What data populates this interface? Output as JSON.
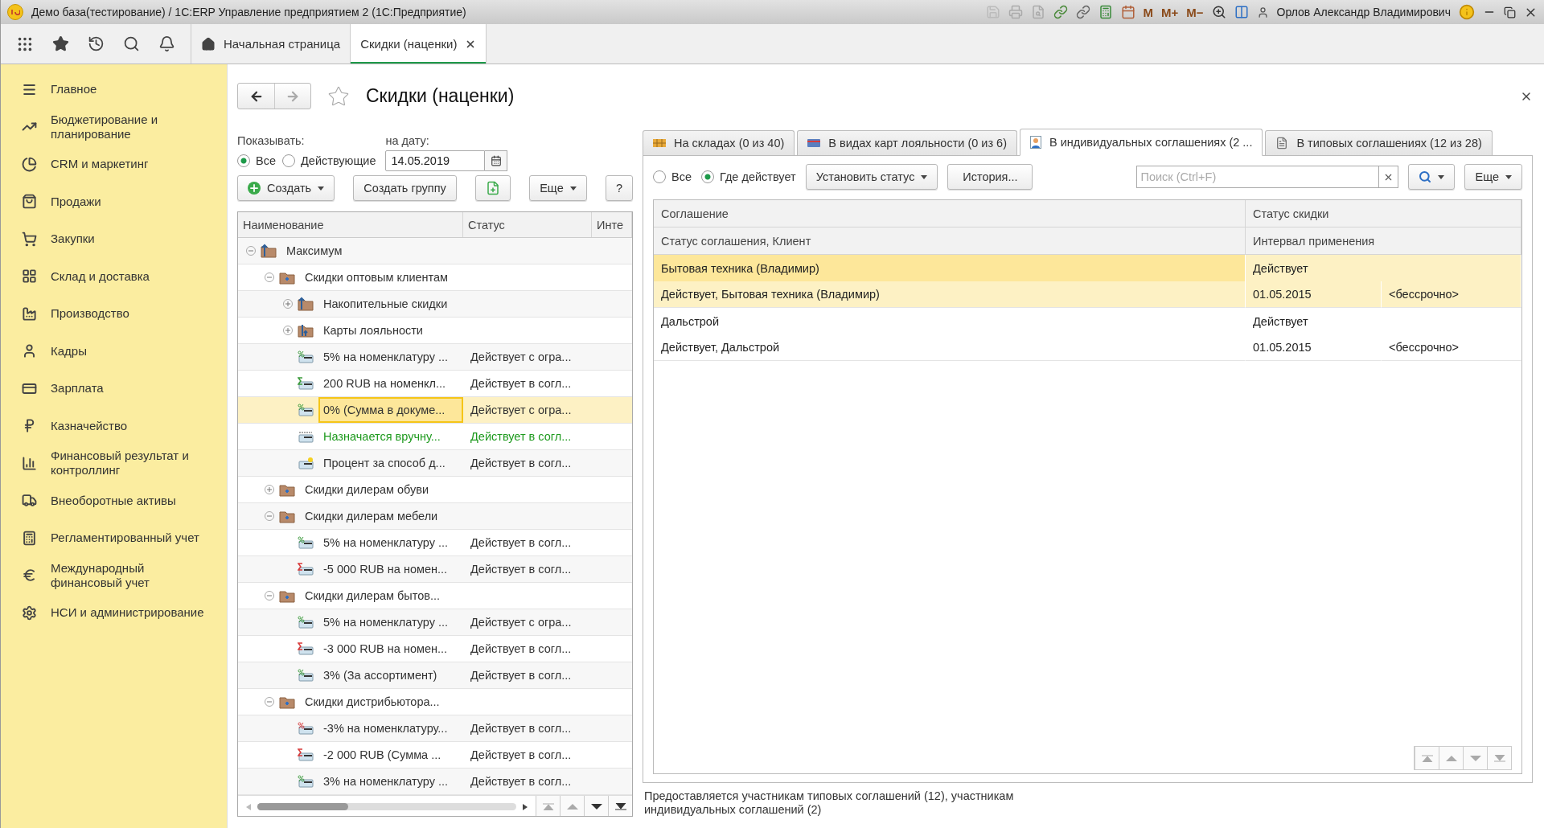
{
  "window": {
    "title": "Демо база(тестирование) / 1С:ERP Управление предприятием 2  (1С:Предприятие)",
    "memory_buttons": [
      "M",
      "M+",
      "M−"
    ],
    "user": "Орлов Александр Владимирович"
  },
  "open_tabs": [
    {
      "label": "Начальная страница",
      "kind": "home",
      "selected": false
    },
    {
      "label": "Скидки (наценки)",
      "kind": "form",
      "selected": true
    }
  ],
  "sidebar": {
    "items": [
      {
        "label": "Главное"
      },
      {
        "label": "Бюджетирование и планирование"
      },
      {
        "label": "CRM и маркетинг"
      },
      {
        "label": "Продажи"
      },
      {
        "label": "Закупки"
      },
      {
        "label": "Склад и доставка"
      },
      {
        "label": "Производство"
      },
      {
        "label": "Кадры"
      },
      {
        "label": "Зарплата"
      },
      {
        "label": "Казначейство"
      },
      {
        "label": "Финансовый результат и контроллинг"
      },
      {
        "label": "Внеоборотные активы"
      },
      {
        "label": "Регламентированный учет"
      },
      {
        "label": "Международный финансовый учет"
      },
      {
        "label": "НСИ и администрирование"
      }
    ]
  },
  "form": {
    "title": "Скидки (наценки)",
    "show_label": "Показывать:",
    "show_options": [
      {
        "label": "Все",
        "selected": true
      },
      {
        "label": "Действующие",
        "selected": false
      }
    ],
    "date_label": "на дату:",
    "date": "14.05.2019",
    "buttons": [
      {
        "kind": "create",
        "label": "Создать"
      },
      {
        "kind": "plain",
        "label": "Создать группу"
      },
      {
        "kind": "copy"
      },
      {
        "kind": "menu",
        "label": "Еще"
      },
      {
        "kind": "plain",
        "label": "?"
      }
    ]
  },
  "tree": {
    "columns": [
      "Наименование",
      "Статус",
      "Инте"
    ],
    "rows": [
      {
        "kind": "group-up",
        "name": "Максимум",
        "expanded": true,
        "selected": false,
        "children": [
          {
            "kind": "group",
            "name": "Скидки оптовым клиентам",
            "expanded": true,
            "selected": false,
            "children": [
              {
                "kind": "group-up",
                "name": "Накопительные скидки",
                "expanded": false,
                "selected": false
              },
              {
                "kind": "group-cards",
                "name": "Карты лояльности",
                "expanded": false,
                "selected": false
              },
              {
                "kind": "percent",
                "name": "5% на номенклатуру ...",
                "status": "Действует с огра...",
                "color": "#333333",
                "selected": false
              },
              {
                "kind": "sum",
                "name": "200 RUB на номенкл...",
                "status": "Действует в согл...",
                "color": "#333333",
                "selected": false
              },
              {
                "kind": "percent",
                "name": "0% (Сумма в докуме...",
                "status": "Действует с огра...",
                "color": "#333333",
                "selected": true
              },
              {
                "kind": "manual",
                "name": "Назначается вручну...",
                "status": "Действует в согл...",
                "color": "#1e9a1e",
                "selected": false
              },
              {
                "kind": "method",
                "name": "Процент за способ д...",
                "status": "Действует в согл...",
                "color": "#333333",
                "selected": false
              }
            ]
          },
          {
            "kind": "group",
            "name": "Скидки дилерам обуви",
            "expanded": false,
            "selected": false
          },
          {
            "kind": "group",
            "name": "Скидки дилерам мебели",
            "expanded": true,
            "selected": false,
            "children": [
              {
                "kind": "percent",
                "name": "5% на номенклатуру ...",
                "status": "Действует в согл...",
                "color": "#333333",
                "selected": false
              },
              {
                "kind": "sum-negative",
                "name": "-5 000 RUB на номен...",
                "status": "Действует в согл...",
                "color": "#333333",
                "selected": false
              }
            ]
          },
          {
            "kind": "group",
            "name": "Скидки дилерам бытов...",
            "expanded": true,
            "selected": false,
            "children": [
              {
                "kind": "percent",
                "name": "5% на номенклатуру ...",
                "status": "Действует с огра...",
                "color": "#333333",
                "selected": false
              },
              {
                "kind": "sum-negative",
                "name": "-3 000 RUB на номен...",
                "status": "Действует в согл...",
                "color": "#333333",
                "selected": false
              },
              {
                "kind": "percent",
                "name": "3% (За ассортимент)",
                "status": "Действует в согл...",
                "color": "#333333",
                "selected": false
              }
            ]
          },
          {
            "kind": "group",
            "name": "Скидки дистрибьютора...",
            "expanded": true,
            "selected": false,
            "children": [
              {
                "kind": "percent-negative",
                "name": "-3% на номенклатуру...",
                "status": "Действует в согл...",
                "color": "#333333",
                "selected": false
              },
              {
                "kind": "sum-negative",
                "name": "-2 000 RUB (Сумма ...",
                "status": "Действует в согл...",
                "color": "#333333",
                "selected": false
              },
              {
                "kind": "percent",
                "name": "3% на номенклатуру ...",
                "status": "Действует в согл...",
                "color": "#333333",
                "selected": false
              }
            ]
          }
        ]
      }
    ]
  },
  "details": {
    "tabs": [
      {
        "label": "На складах (0 из 40)",
        "kind": "warehouse",
        "selected": false
      },
      {
        "label": "В видах карт лояльности (0 из 6)",
        "kind": "card",
        "selected": false
      },
      {
        "label": "В индивидуальных соглашениях (2 ...",
        "kind": "person",
        "selected": true
      },
      {
        "label": "В типовых соглашениях (12 из 28)",
        "kind": "document",
        "selected": false
      }
    ],
    "filter": [
      {
        "label": "Все",
        "selected": false
      },
      {
        "label": "Где действует",
        "selected": true
      }
    ],
    "buttons": [
      {
        "kind": "menu",
        "label": "Установить статус"
      },
      {
        "kind": "plain",
        "label": "История..."
      }
    ],
    "search": {
      "placeholder": "Поиск (Ctrl+F)"
    },
    "more": "Еще",
    "columns": [
      [
        "Соглашение",
        "Статус скидки"
      ],
      [
        "Статус соглашения, Клиент",
        "Интервал применения"
      ]
    ],
    "rows": [
      {
        "agreement": "Бытовая техника (Владимир)",
        "discount_status": "Действует",
        "client": "Действует, Бытовая техника (Владимир)",
        "start": "01.05.2015",
        "end": "<бессрочно>",
        "selected": true
      },
      {
        "agreement": "Дальстрой",
        "discount_status": "Действует",
        "client": "Действует, Дальстрой",
        "start": "01.05.2015",
        "end": "<бессрочно>",
        "selected": false
      }
    ],
    "footer": "Предоставляется участникам типовых соглашений (12), участникам индивидуальных соглашений (2)"
  }
}
